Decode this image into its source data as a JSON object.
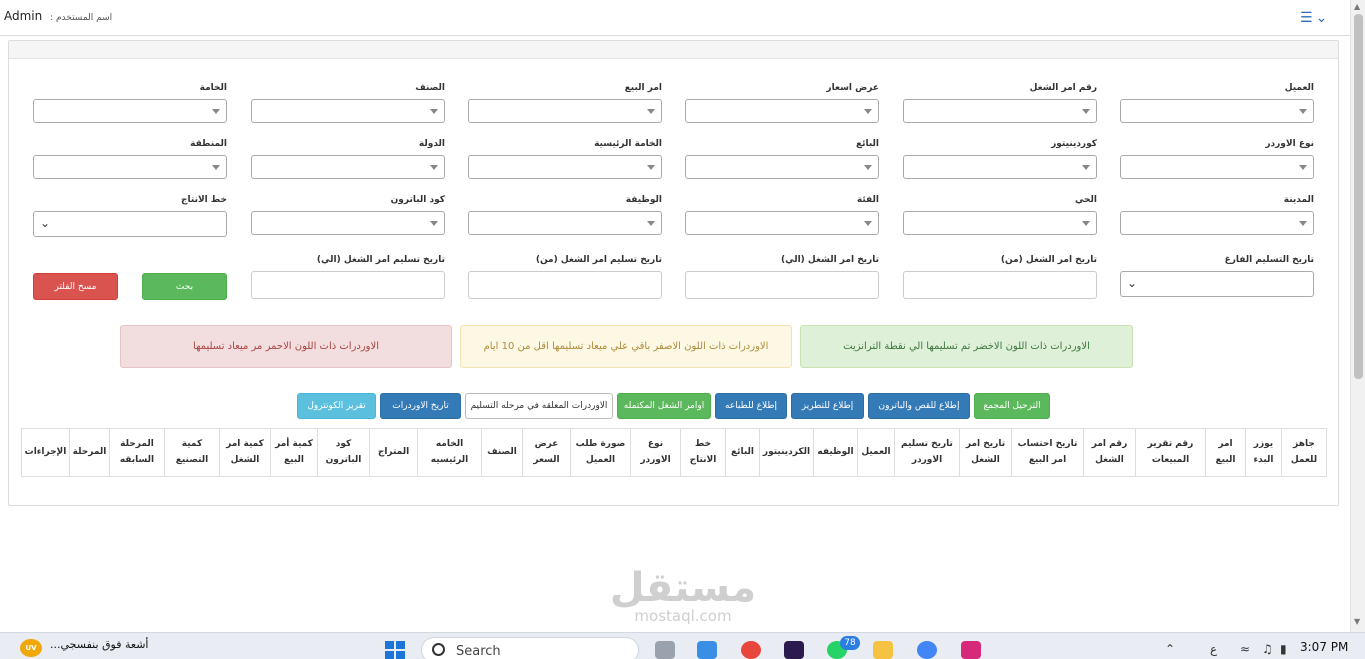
{
  "header": {
    "user_name": "Admin",
    "user_label": ": اسم المستخدم",
    "menu_icon": "list-icon"
  },
  "filters": {
    "row1": [
      "العميل",
      "رقم امر الشغل",
      "عرض اسعار",
      "امر البيع",
      "الصنف",
      "الخامة"
    ],
    "row2": [
      "نوع الاوردر",
      "كوردينيتور",
      "البائع",
      "الخامة الرئيسية",
      "الدولة",
      "المنطقة"
    ],
    "row3": [
      "المدينة",
      "الحي",
      "الفئة",
      "الوظيفة",
      "كود الباترون",
      "خط الانتاج"
    ],
    "row4": [
      "تاريخ التسليم الفارغ",
      "تاريخ امر الشغل (من)",
      "تاريخ امر الشغل (الي)",
      "تاريخ تسليم امر الشغل (من)",
      "تاريخ تسليم امر الشغل (الي)"
    ]
  },
  "buttons": {
    "search": "بحث",
    "clear": "مسح الفلتر"
  },
  "alerts": {
    "green": "الاوردرات ذات اللون الاخضر تم تسليمها الي نقطة الترانزيت",
    "yellow": "الاوردرات ذات اللون الاصفر باقي علي ميعاد تسليمها اقل من 10 ايام",
    "red": "الاوردرات ذات اللون الاحمر مر ميعاد تسليمها"
  },
  "toolbar": [
    "الترحيل المجمع",
    "إطلاع للقص والباترون",
    "إطلاع للتطريز",
    "إطلاع للطباعه",
    "اوامر الشغل المكتمله",
    "الاوردرات المعلقه في مرحله التسليم",
    "تاريخ الاوردرات",
    "تقرير الكونترول"
  ],
  "table": {
    "headers": [
      "جاهز للعمل",
      "يوزر البدء",
      "امر البيع",
      "رقم تقرير المبيعات",
      "رقم امر الشغل",
      "تاريخ احتساب امر البيع",
      "تاريخ امر الشغل",
      "تاريخ تسليم الاوردر",
      "العميل",
      "الوظيفه",
      "الكردينيتور",
      "البائع",
      "خط الانتاج",
      "نوع الاوردر",
      "صورة طلب العميل",
      "عرض السعر",
      "الصنف",
      "الخامه الرئيسيه",
      "المتراج",
      "كود الباترون",
      "كمية أمر البيع",
      "كمية امر الشغل",
      "كمية التصنيع",
      "المرحلة السابقه",
      "المرحلة",
      "الإجراءات"
    ]
  },
  "watermark": {
    "arabic": "مستقل",
    "latin": "mostaql.com"
  },
  "taskbar": {
    "weather_badge": "UV",
    "news": "أشعة فوق بنفسجي...",
    "search_placeholder": "Search",
    "whatsapp_badge": "78",
    "lang": "ع",
    "time": "3:07 PM"
  },
  "colors": {
    "green": "#5cb85c",
    "red": "#d9534f",
    "blue": "#337ab7",
    "cyan": "#5bc0de"
  }
}
